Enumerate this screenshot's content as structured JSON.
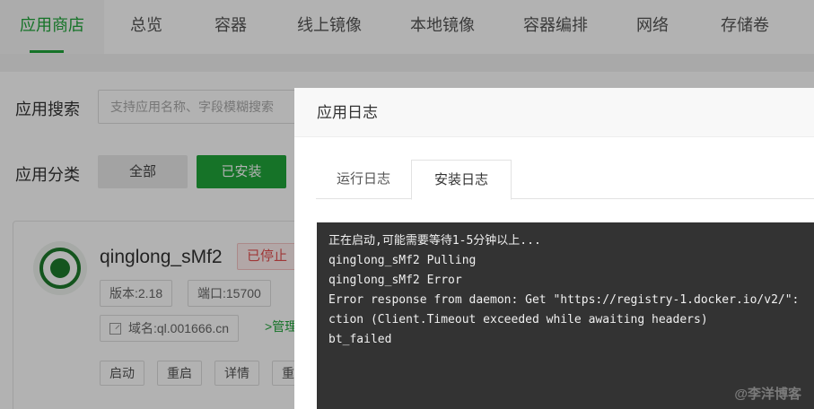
{
  "nav": {
    "tabs": [
      {
        "label": "应用商店",
        "active": true
      },
      {
        "label": "总览"
      },
      {
        "label": "容器"
      },
      {
        "label": "线上镜像"
      },
      {
        "label": "本地镜像"
      },
      {
        "label": "容器编排"
      },
      {
        "label": "网络"
      },
      {
        "label": "存储卷"
      }
    ]
  },
  "search": {
    "label": "应用搜索",
    "placeholder": "支持应用名称、字段模糊搜索"
  },
  "category": {
    "label": "应用分类",
    "all": "全部",
    "installed": "已安装"
  },
  "app_card": {
    "name": "qinglong_sMf2",
    "status": "已停止",
    "version": "版本:2.18",
    "port": "端口:15700",
    "domain": "域名:ql.001666.cn",
    "manage": ">管理",
    "actions": [
      "启动",
      "重启",
      "详情",
      "重"
    ]
  },
  "modal": {
    "title": "应用日志",
    "tabs": [
      "运行日志",
      "安装日志"
    ],
    "active_tab": "安装日志",
    "log_lines": [
      "正在启动,可能需要等待1-5分钟以上...",
      "qinglong_sMf2 Pulling",
      "qinglong_sMf2 Error",
      "Error response from daemon: Get \"https://registry-1.docker.io/v2/\":",
      "ction (Client.Timeout exceeded while awaiting headers)",
      "bt_failed"
    ],
    "watermark": "@李洋博客"
  },
  "colors": {
    "accent": "#20a53a",
    "danger": "#e45050",
    "console_bg": "#333333"
  }
}
